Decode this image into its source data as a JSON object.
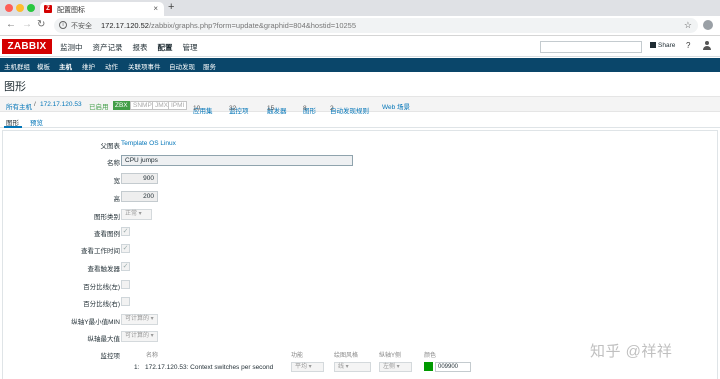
{
  "browser": {
    "tab_title": "配置图标",
    "tab_favicon": "Z",
    "insecure_label": "不安全",
    "url_host": "172.17.120.52",
    "url_path": "/zabbix/graphs.php?form=update&graphid=804&hostid=10255"
  },
  "header": {
    "logo": "ZABBIX",
    "menu": [
      "监测中",
      "资产记录",
      "报表",
      "配置",
      "管理"
    ],
    "share": "Share",
    "help": "?"
  },
  "submenu": [
    "主机群组",
    "模板",
    "主机",
    "维护",
    "动作",
    "关联项事件",
    "自动发现",
    "服务"
  ],
  "page_title": "图形",
  "hostnav": {
    "all_hosts": "所有主机",
    "sep": "/",
    "host": "172.17.120.53",
    "enabled": "已启用",
    "zbx": "ZBX",
    "snmp": "SNMP",
    "jmx": "JMX",
    "ipmi": "IPMI",
    "applications": "应用集",
    "applications_count": "10",
    "items": "监控项",
    "items_count": "32",
    "triggers": "触发器",
    "triggers_count": "15",
    "graphs": "图形",
    "graphs_count": "8",
    "discovery": "自动发现规则",
    "discovery_count": "2",
    "web": "Web 场景"
  },
  "tabs": [
    "图形",
    "预览"
  ],
  "form": {
    "parent_label": "父图表",
    "parent_value": "Template OS Linux",
    "name_label": "名称",
    "name_value": "CPU jumps",
    "width_label": "宽",
    "width_value": "900",
    "height_label": "高",
    "height_value": "200",
    "type_label": "图形类别",
    "type_value": "正常",
    "show_legend_label": "查看图例",
    "show_worktime_label": "查看工作时间",
    "show_triggers_label": "查看触发器",
    "percent_left_label": "百分比线(左)",
    "percent_right_label": "百分比线(右)",
    "ymin_label": "纵轴Y最小值MIN",
    "ymin_value": "可计算的",
    "ymax_label": "纵轴最大值",
    "ymax_value": "可计算的",
    "items_label": "监控项"
  },
  "items_table": {
    "headers": [
      "名称",
      "功能",
      "绘图风格",
      "纵轴Y侧",
      "颜色"
    ],
    "rows": [
      {
        "num": "1:",
        "name": "172.17.120.53: Context switches per second",
        "func": "平均",
        "style": "线",
        "side": "左侧",
        "color_hex": "009900"
      }
    ]
  },
  "colors": {
    "accent": "#d40000",
    "submenu_bg": "#0a466a",
    "link": "#0275b8",
    "enabled": "#429e47",
    "item_color": "#009900"
  },
  "watermark": "知乎 @祥祥"
}
